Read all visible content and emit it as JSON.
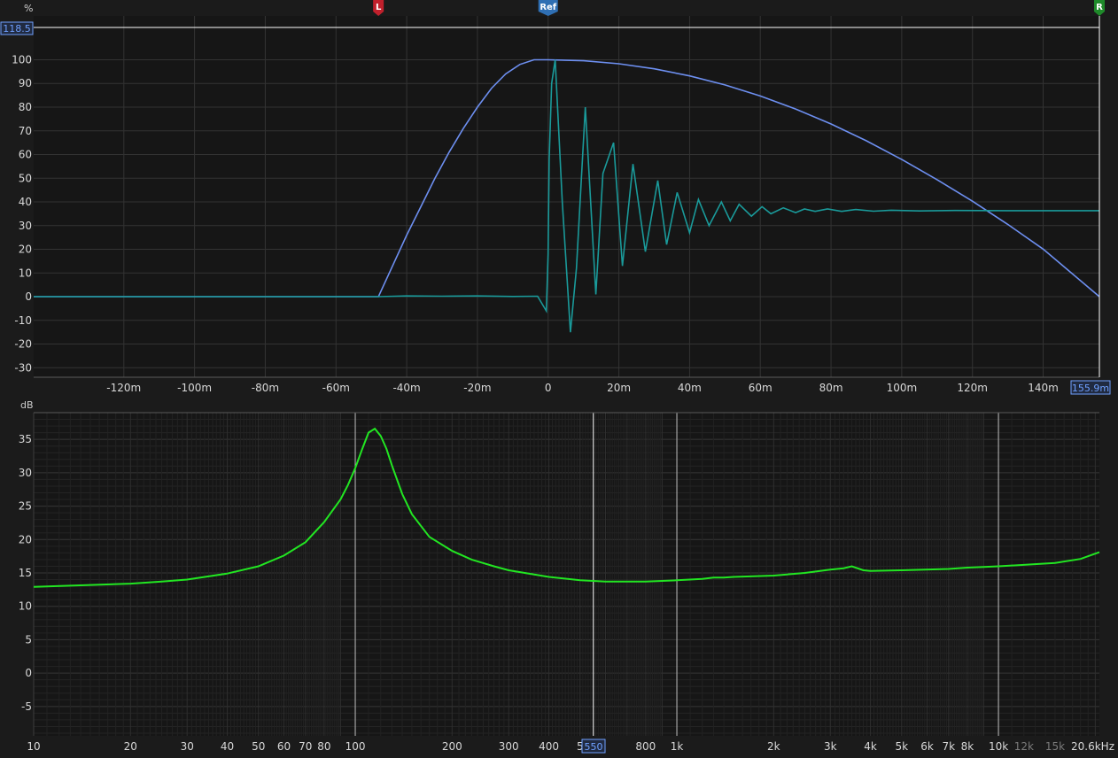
{
  "chart_data": [
    {
      "type": "line",
      "ylabel": "%",
      "xlim": [
        -0.1455,
        0.1559
      ],
      "ylim": [
        -34,
        118.5
      ],
      "y_ticks": [
        100,
        90,
        80,
        70,
        60,
        50,
        40,
        30,
        20,
        10,
        0,
        -10,
        -20,
        -30
      ],
      "x_ticks": [
        -0.12,
        -0.1,
        -0.08,
        -0.06,
        -0.04,
        -0.02,
        0,
        0.02,
        0.04,
        0.06,
        0.08,
        0.1,
        0.12,
        0.14
      ],
      "x_tick_labels": [
        "-120m",
        "-100m",
        "-80m",
        "-60m",
        "-40m",
        "-20m",
        "0",
        "20m",
        "40m",
        "60m",
        "80m",
        "100m",
        "120m",
        "140m"
      ],
      "grid": true,
      "readouts": {
        "y_top": "118.5",
        "x_right": "155.9m"
      },
      "markers": [
        {
          "label": "L",
          "x": -0.048,
          "color": "#c0202c"
        },
        {
          "label": "Ref",
          "x": 0.0,
          "color": "#2f6fb3"
        },
        {
          "label": "R",
          "x": 0.1559,
          "color": "#1f8a2a"
        }
      ],
      "colors": {
        "window": "#6d8ff0",
        "response": "#1a9a9a"
      },
      "series": [
        {
          "kind": "window",
          "x": [
            -0.1455,
            -0.048,
            -0.044,
            -0.04,
            -0.036,
            -0.032,
            -0.028,
            -0.024,
            -0.02,
            -0.016,
            -0.012,
            -0.008,
            -0.004,
            0.0,
            0.01,
            0.02,
            0.03,
            0.04,
            0.05,
            0.06,
            0.07,
            0.08,
            0.09,
            0.1,
            0.11,
            0.12,
            0.13,
            0.14,
            0.1559
          ],
          "y": [
            0,
            0,
            13,
            26,
            38,
            50,
            61,
            71,
            80,
            88,
            94,
            98,
            100,
            100,
            99.6,
            98.3,
            96.2,
            93.2,
            89.4,
            84.7,
            79.2,
            72.9,
            65.8,
            57.9,
            49.4,
            40.3,
            30.5,
            20.1,
            0
          ]
        },
        {
          "kind": "response",
          "x": [
            -0.1455,
            -0.048,
            -0.04,
            -0.03,
            -0.02,
            -0.01,
            -0.003,
            -0.0005,
            0.0,
            0.0003,
            0.001,
            0.002,
            0.004,
            0.0063,
            0.008,
            0.0105,
            0.0135,
            0.0155,
            0.0185,
            0.021,
            0.024,
            0.0275,
            0.031,
            0.0335,
            0.0365,
            0.04,
            0.0425,
            0.0455,
            0.049,
            0.0515,
            0.054,
            0.0575,
            0.0605,
            0.063,
            0.0665,
            0.07,
            0.0725,
            0.0755,
            0.079,
            0.083,
            0.087,
            0.092,
            0.097,
            0.105,
            0.115,
            0.13,
            0.1559
          ],
          "y": [
            0,
            0,
            0.3,
            0.2,
            0.3,
            0.1,
            0.2,
            -6,
            18,
            58,
            90,
            100,
            40,
            -15,
            12,
            80,
            1,
            52,
            65,
            13,
            56,
            19,
            49,
            22,
            44,
            27,
            41,
            30,
            40,
            32,
            39,
            34,
            38,
            35,
            37.5,
            35.5,
            37,
            36,
            37,
            36,
            36.8,
            36.1,
            36.5,
            36.2,
            36.4,
            36.3,
            36.3
          ]
        }
      ]
    },
    {
      "type": "line",
      "ylabel": "dB",
      "x_scale": "log",
      "xlim": [
        10,
        20600
      ],
      "ylim": [
        -9.4,
        39
      ],
      "y_ticks": [
        35,
        30,
        25,
        20,
        15,
        10,
        5,
        0,
        -5
      ],
      "x_tick_labels": [
        {
          "v": 10,
          "t": "10"
        },
        {
          "v": 20,
          "t": "20"
        },
        {
          "v": 30,
          "t": "30"
        },
        {
          "v": 40,
          "t": "40"
        },
        {
          "v": 50,
          "t": "50"
        },
        {
          "v": 60,
          "t": "60"
        },
        {
          "v": 70,
          "t": "70"
        },
        {
          "v": 80,
          "t": "80"
        },
        {
          "v": 100,
          "t": "100"
        },
        {
          "v": 200,
          "t": "200"
        },
        {
          "v": 300,
          "t": "300"
        },
        {
          "v": 400,
          "t": "400"
        },
        {
          "v": 500,
          "t": "5"
        },
        {
          "v": 800,
          "t": "800"
        },
        {
          "v": 1000,
          "t": "1k"
        },
        {
          "v": 2000,
          "t": "2k"
        },
        {
          "v": 3000,
          "t": "3k"
        },
        {
          "v": 4000,
          "t": "4k"
        },
        {
          "v": 5000,
          "t": "5k"
        },
        {
          "v": 6000,
          "t": "6k"
        },
        {
          "v": 7000,
          "t": "7k"
        },
        {
          "v": 8000,
          "t": "8k"
        },
        {
          "v": 10000,
          "t": "10k"
        },
        {
          "v": 12000,
          "t": "12k",
          "dim": true
        },
        {
          "v": 15000,
          "t": "15k",
          "dim": true
        },
        {
          "v": 20600,
          "t": "20.6kHz"
        }
      ],
      "highlight_lines": [
        100,
        550,
        1000,
        10000
      ],
      "grid": true,
      "readouts": {
        "x_cursor": "550"
      },
      "colors": {
        "trace": "#22e622"
      },
      "series": [
        {
          "name": "",
          "x": [
            10,
            15,
            20,
            25,
            30,
            40,
            50,
            60,
            70,
            80,
            90,
            95,
            100,
            105,
            110,
            115,
            120,
            125,
            130,
            140,
            150,
            170,
            200,
            230,
            270,
            300,
            400,
            500,
            600,
            800,
            1000,
            1200,
            1300,
            1400,
            1500,
            2000,
            2500,
            3000,
            3300,
            3500,
            3800,
            4000,
            5000,
            7000,
            8000,
            9000,
            10000,
            12000,
            15000,
            18000,
            20600
          ],
          "y": [
            12.9,
            13.2,
            13.4,
            13.7,
            14.0,
            14.9,
            16.0,
            17.6,
            19.6,
            22.6,
            26.0,
            28.2,
            30.7,
            33.5,
            36.0,
            36.6,
            35.5,
            33.6,
            31.1,
            26.8,
            23.8,
            20.4,
            18.3,
            17.0,
            16.0,
            15.4,
            14.4,
            13.9,
            13.7,
            13.7,
            13.9,
            14.1,
            14.3,
            14.3,
            14.4,
            14.6,
            15.0,
            15.5,
            15.7,
            16.0,
            15.4,
            15.3,
            15.4,
            15.6,
            15.8,
            15.9,
            16.0,
            16.2,
            16.5,
            17.1,
            18.1
          ]
        }
      ]
    }
  ]
}
